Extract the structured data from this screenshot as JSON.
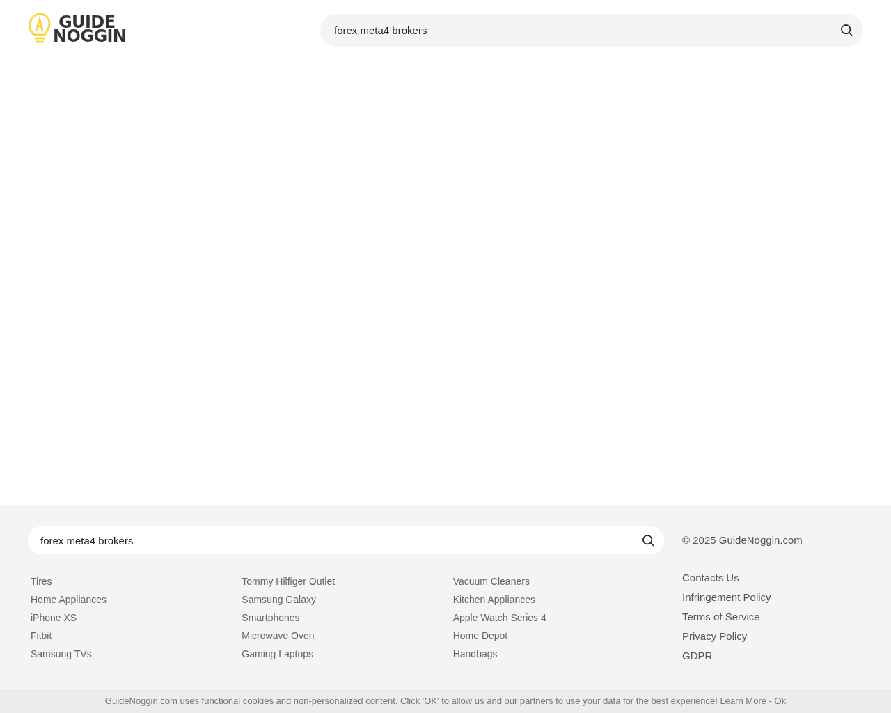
{
  "logo": {
    "line_1": "GUIDE",
    "line_2": "NOGGIN"
  },
  "header_search": {
    "value": "forex meta4 brokers"
  },
  "footer": {
    "search": {
      "value": "forex meta4 brokers"
    },
    "copyright": "© 2025 GuideNoggin.com",
    "link_columns": [
      [
        "Tires",
        "Home Appliances",
        "iPhone XS",
        "Fitbit",
        "Samsung TVs"
      ],
      [
        "Tommy Hilfiger Outlet",
        "Samsung Galaxy",
        "Smartphones",
        "Microwave Oven",
        "Gaming Laptops"
      ],
      [
        "Vacuum Cleaners",
        "Kitchen Appliances",
        "Apple Watch Series 4",
        "Home Depot",
        "Handbags"
      ]
    ],
    "policy_links": [
      "Contacts Us",
      "Infringement Policy",
      "Terms of Service",
      "Privacy Policy",
      "GDPR"
    ]
  },
  "cookie_bar": {
    "text": "GuideNoggin.com uses functional cookies and non-personalized content. Click 'OK' to allow us and our partners to use your data for the best experience!",
    "learn_more": "Learn More",
    "separator": "-",
    "ok": "Ok"
  }
}
